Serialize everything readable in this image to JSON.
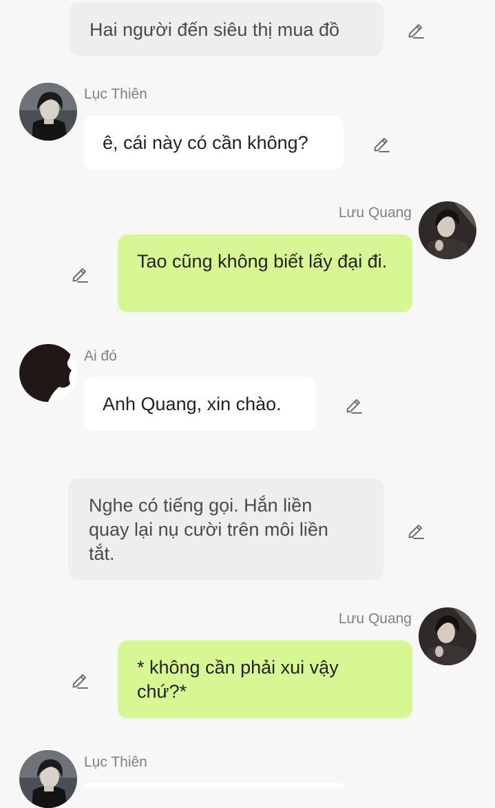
{
  "colors": {
    "background": "#f7f7f7",
    "narration_bubble": "#eeeeee",
    "incoming_bubble": "#ffffff",
    "outgoing_bubble": "#d7f795",
    "name_text": "#808080"
  },
  "messages": [
    {
      "type": "narration",
      "text": "Hai người đến siêu thị mua đồ"
    },
    {
      "type": "incoming",
      "sender": "Lục Thiên",
      "avatar": "avatar-luc-thien",
      "text": "ê, cái này có cần không?"
    },
    {
      "type": "outgoing",
      "sender": "Lưu Quang",
      "avatar": "avatar-luu-quang",
      "text": "Tao cũng không biết lấy đại đi."
    },
    {
      "type": "incoming",
      "sender": "Ai đó",
      "avatar": "avatar-silhouette",
      "text": "Anh Quang, xin chào."
    },
    {
      "type": "narration",
      "text": "Nghe có tiếng gọi. Hắn liền quay lại nụ cười trên môi liền tắt."
    },
    {
      "type": "outgoing",
      "sender": "Lưu Quang",
      "avatar": "avatar-luu-quang",
      "text": "* không cần phải xui vậy chứ?*"
    },
    {
      "type": "incoming",
      "sender": "Lục Thiên",
      "avatar": "avatar-luc-thien",
      "text": ""
    }
  ],
  "edit_icon": "pencil-edit-icon"
}
